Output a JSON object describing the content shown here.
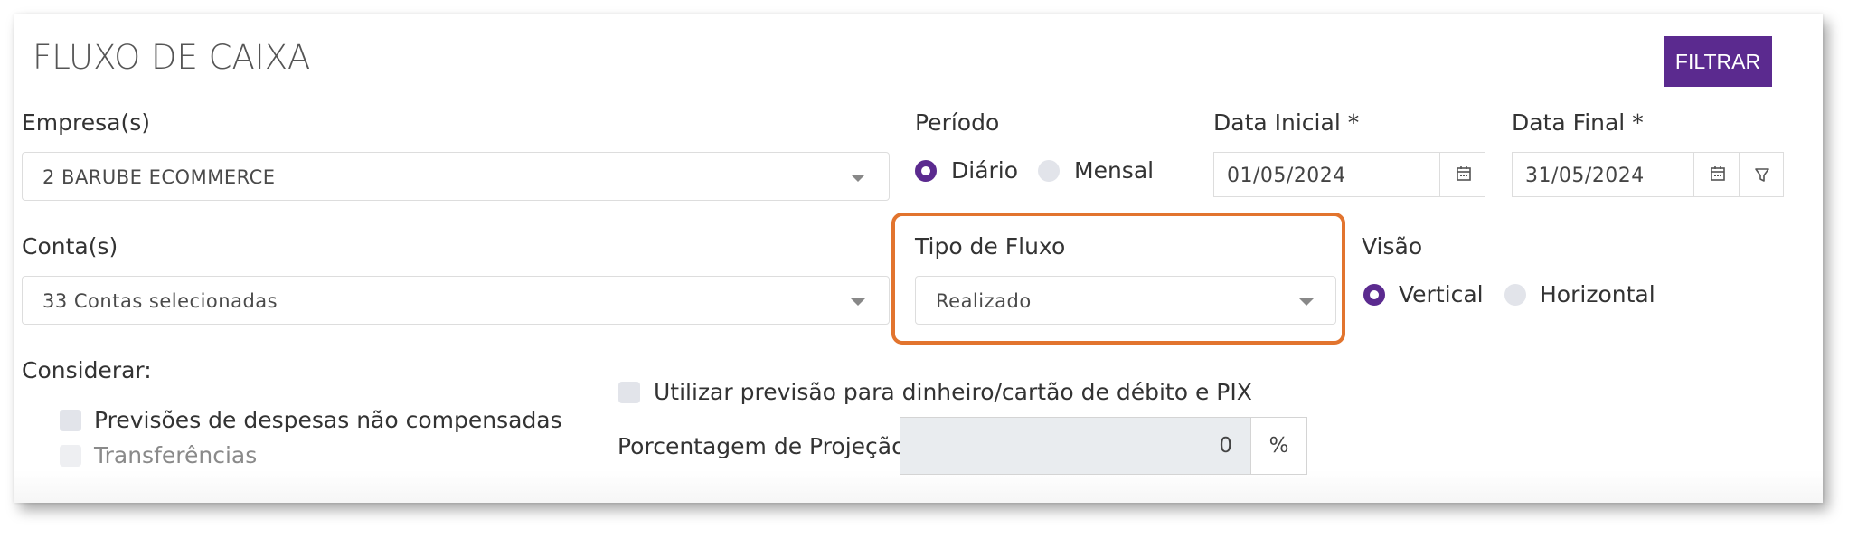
{
  "header": {
    "title": "FLUXO DE CAIXA",
    "filter_label": "FILTRAR"
  },
  "empresa": {
    "label": "Empresa(s)",
    "value": "2 BARUBE ECOMMERCE"
  },
  "periodo": {
    "label": "Período",
    "options": [
      "Diário",
      "Mensal"
    ],
    "selected": "Diário"
  },
  "data_inicial": {
    "label": "Data Inicial *",
    "value": "01/05/2024"
  },
  "data_final": {
    "label": "Data Final *",
    "value": "31/05/2024"
  },
  "conta": {
    "label": "Conta(s)",
    "value": "33 Contas selecionadas"
  },
  "tipo_fluxo": {
    "label": "Tipo de Fluxo",
    "value": "Realizado"
  },
  "visao": {
    "label": "Visão",
    "options": [
      "Vertical",
      "Horizontal"
    ],
    "selected": "Vertical"
  },
  "considerar": {
    "label": "Considerar:",
    "options": [
      "Previsões de despesas não compensadas",
      "Transferências"
    ]
  },
  "previsao_pix": {
    "label": "Utilizar previsão para dinheiro/cartão de débito e PIX"
  },
  "projecao": {
    "label": "Porcentagem de Projeção",
    "value": "0",
    "unit": "%"
  },
  "colors": {
    "accent": "#5b2a8f",
    "highlight": "#e2742e"
  },
  "icons": [
    "calendar-icon",
    "filter-icon",
    "caret-down-icon"
  ]
}
